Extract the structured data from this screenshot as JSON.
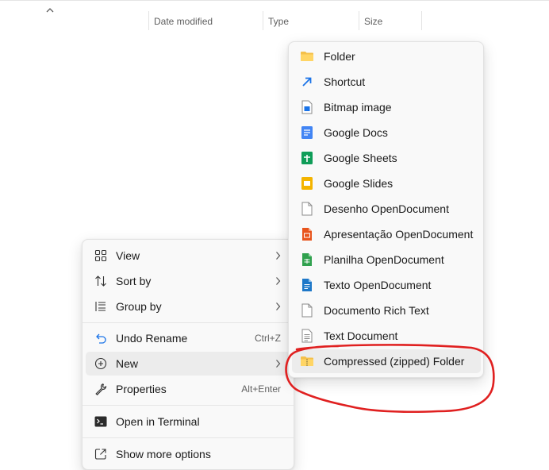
{
  "columns": {
    "date_modified": "Date modified",
    "type": "Type",
    "size": "Size"
  },
  "context_menu": {
    "items": [
      {
        "label": "View",
        "icon": "grid-icon"
      },
      {
        "label": "Sort by",
        "icon": "sort-icon"
      },
      {
        "label": "Group by",
        "icon": "group-icon"
      },
      {
        "label": "Undo Rename",
        "icon": "undo-icon",
        "shortcut": "Ctrl+Z"
      },
      {
        "label": "New",
        "icon": "new-icon"
      },
      {
        "label": "Properties",
        "icon": "wrench-icon",
        "shortcut": "Alt+Enter"
      },
      {
        "label": "Open in Terminal",
        "icon": "terminal-icon"
      },
      {
        "label": "Show more options",
        "icon": "share-icon"
      }
    ]
  },
  "new_submenu": {
    "items": [
      {
        "label": "Folder",
        "icon": "folder-icon",
        "color": "#f4c04a"
      },
      {
        "label": "Shortcut",
        "icon": "shortcut-arrow-icon",
        "color": "#1a73e8"
      },
      {
        "label": "Bitmap image",
        "icon": "bitmap-file-icon",
        "color": "#1a73e8"
      },
      {
        "label": "Google Docs",
        "icon": "google-docs-icon",
        "color": "#4285f4"
      },
      {
        "label": "Google Sheets",
        "icon": "google-sheets-icon",
        "color": "#0f9d58"
      },
      {
        "label": "Google Slides",
        "icon": "google-slides-icon",
        "color": "#f4b400"
      },
      {
        "label": "Desenho OpenDocument",
        "icon": "blank-document-icon",
        "color": "#ffffff"
      },
      {
        "label": "Apresentação OpenDocument",
        "icon": "odp-file-icon",
        "color": "#e8541c"
      },
      {
        "label": "Planilha OpenDocument",
        "icon": "ods-file-icon",
        "color": "#30a14e"
      },
      {
        "label": "Texto OpenDocument",
        "icon": "odt-file-icon",
        "color": "#1e78c8"
      },
      {
        "label": "Documento Rich Text",
        "icon": "blank-document-icon",
        "color": "#ffffff"
      },
      {
        "label": "Text Document",
        "icon": "text-document-icon",
        "color": "#ffffff"
      },
      {
        "label": "Compressed (zipped) Folder",
        "icon": "zip-folder-icon",
        "color": "#f4c04a"
      }
    ]
  },
  "annotation": {
    "color": "#e02020",
    "shape": "hand-drawn ellipse around Compressed (zipped) Folder"
  }
}
